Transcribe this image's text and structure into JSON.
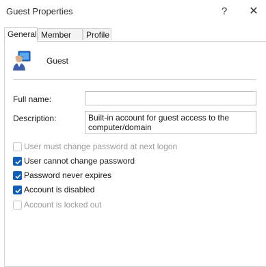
{
  "window": {
    "title": "Guest Properties",
    "help_glyph": "?",
    "close_glyph": "✕"
  },
  "tabs": [
    {
      "label": "General",
      "active": true
    },
    {
      "label": "Member Of",
      "active": false
    },
    {
      "label": "Profile",
      "active": false
    }
  ],
  "general": {
    "user_name": "Guest",
    "user_icon": "user-account-icon",
    "full_name_label": "Full name:",
    "full_name_value": "",
    "description_label": "Description:",
    "description_value": "Built-in account for guest access to the computer/domain"
  },
  "options": [
    {
      "label": "User must change password at next logon",
      "checked": false,
      "enabled": false
    },
    {
      "label": "User cannot change password",
      "checked": true,
      "enabled": true
    },
    {
      "label": "Password never expires",
      "checked": true,
      "enabled": true
    },
    {
      "label": "Account is disabled",
      "checked": true,
      "enabled": true
    },
    {
      "label": "Account is locked out",
      "checked": false,
      "enabled": false
    }
  ],
  "colors": {
    "checkbox_accent": "#0f5fb8",
    "disabled_text": "#9a9a9a"
  }
}
